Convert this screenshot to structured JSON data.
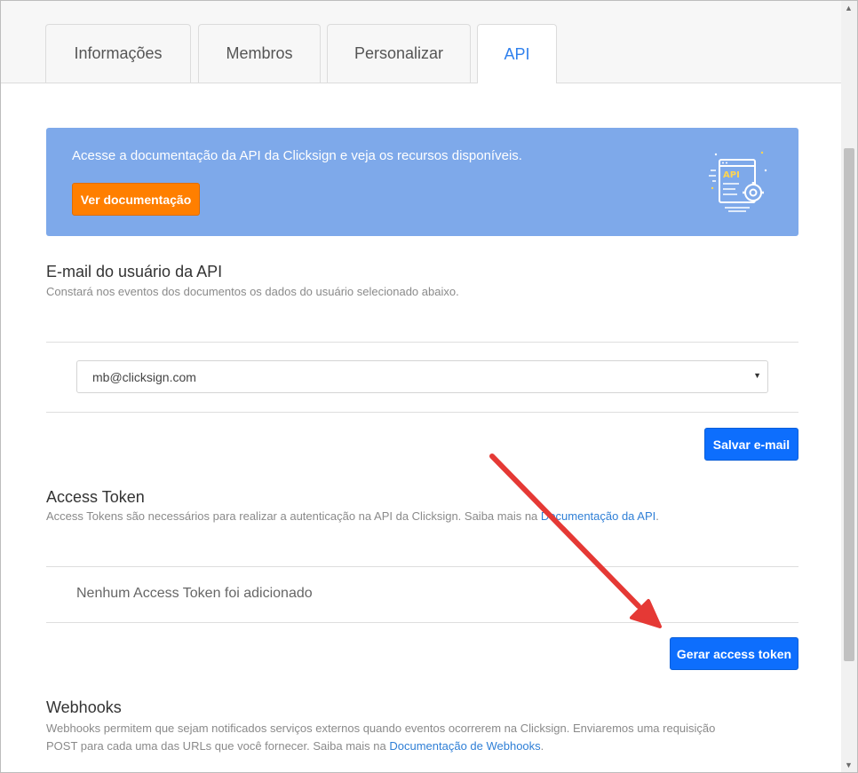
{
  "tabs": [
    {
      "label": "Informações"
    },
    {
      "label": "Membros"
    },
    {
      "label": "Personalizar"
    },
    {
      "label": "API"
    }
  ],
  "banner": {
    "text": "Acesse a documentação da API da Clicksign e veja os recursos disponíveis.",
    "button_label": "Ver documentação",
    "illustration_label": "API"
  },
  "email_section": {
    "title": "E-mail do usuário da API",
    "description": "Constará nos eventos dos documentos os dados do usuário selecionado abaixo.",
    "selected_email": "mb@clicksign.com",
    "save_button": "Salvar e-mail"
  },
  "token_section": {
    "title": "Access Token",
    "description_prefix": "Access Tokens são necessários para realizar a autenticação na API da Clicksign. Saiba mais na ",
    "link_text": "Documentação da API",
    "description_suffix": ".",
    "empty_message": "Nenhum Access Token foi adicionado",
    "generate_button": "Gerar access token"
  },
  "webhooks_section": {
    "title": "Webhooks",
    "description_line1": "Webhooks permitem que sejam notificados serviços externos quando eventos ocorrerem na Clicksign. Enviaremos uma requisição",
    "description_line2_prefix": "POST para cada uma das URLs que você fornecer. Saiba mais na ",
    "link_text": "Documentação de Webhooks",
    "description_suffix": "."
  },
  "colors": {
    "accent": "#2f80ed",
    "banner": "#7ea9ea",
    "orange_button": "#ff7f00",
    "blue_button": "#0d6efd",
    "annotation_arrow": "#e53935"
  }
}
